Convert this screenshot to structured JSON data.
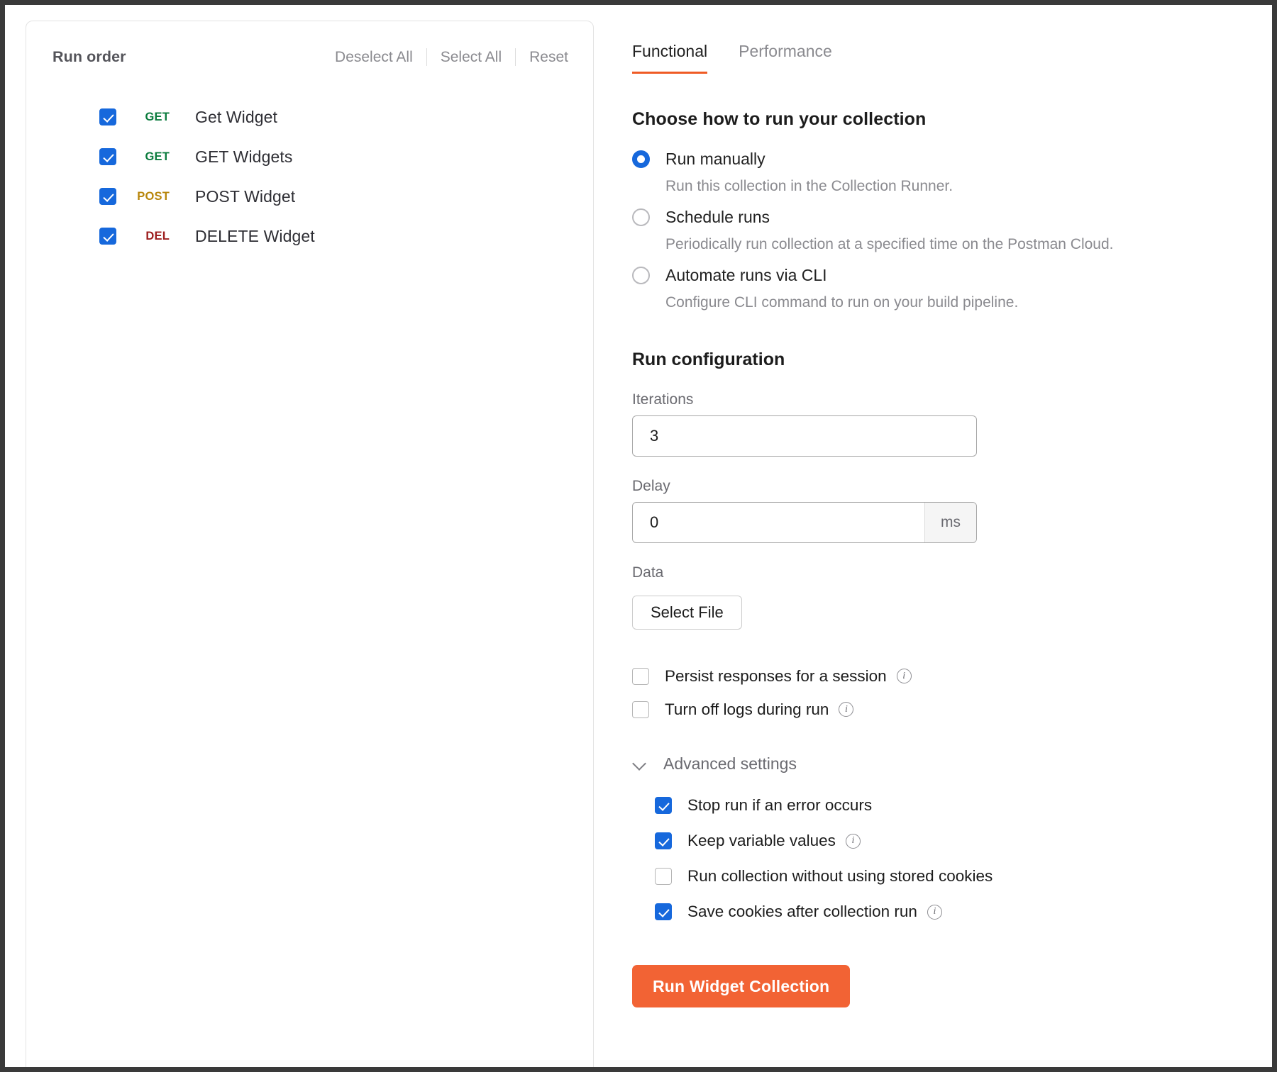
{
  "left_panel": {
    "title": "Run order",
    "actions": [
      {
        "label": "Deselect All"
      },
      {
        "label": "Select All"
      },
      {
        "label": "Reset"
      }
    ],
    "requests": [
      {
        "checked": true,
        "method": "GET",
        "method_color": "#0c7c3e",
        "name": "Get Widget"
      },
      {
        "checked": true,
        "method": "GET",
        "method_color": "#0c7c3e",
        "name": "GET Widgets"
      },
      {
        "checked": true,
        "method": "POST",
        "method_color": "#b8860b",
        "name": "POST Widget"
      },
      {
        "checked": true,
        "method": "DEL",
        "method_color": "#9c1c1c",
        "name": "DELETE Widget"
      }
    ]
  },
  "right_panel": {
    "tabs": [
      {
        "label": "Functional",
        "active": true
      },
      {
        "label": "Performance",
        "active": false
      }
    ],
    "choose_section": {
      "title": "Choose how to run your collection",
      "options": [
        {
          "label": "Run manually",
          "description": "Run this collection in the Collection Runner.",
          "selected": true
        },
        {
          "label": "Schedule runs",
          "description": "Periodically run collection at a specified time on the Postman Cloud.",
          "selected": false
        },
        {
          "label": "Automate runs via CLI",
          "description": "Configure CLI command to run on your build pipeline.",
          "selected": false
        }
      ]
    },
    "run_configuration": {
      "title": "Run configuration",
      "iterations": {
        "label": "Iterations",
        "value": "3"
      },
      "delay": {
        "label": "Delay",
        "value": "0",
        "suffix": "ms"
      },
      "data": {
        "label": "Data",
        "button_label": "Select File"
      },
      "options": [
        {
          "label": "Persist responses for a session",
          "checked": false,
          "info": true,
          "info_glyph": "i"
        },
        {
          "label": "Turn off logs during run",
          "checked": false,
          "info": true,
          "info_glyph": "i"
        }
      ],
      "advanced": {
        "label": "Advanced settings",
        "expanded": true,
        "options": [
          {
            "label": "Stop run if an error occurs",
            "checked": true,
            "info": false,
            "info_glyph": "i"
          },
          {
            "label": "Keep variable values",
            "checked": true,
            "info": true,
            "info_glyph": "i"
          },
          {
            "label": "Run collection without using stored cookies",
            "checked": false,
            "info": false,
            "info_glyph": "i"
          },
          {
            "label": "Save cookies after collection run",
            "checked": true,
            "info": true,
            "info_glyph": "i"
          }
        ]
      },
      "run_button_label": "Run Widget Collection"
    }
  },
  "colors": {
    "accent_orange": "#f26334",
    "checkbox_blue": "#1668dc",
    "get_green": "#0c7c3e",
    "post_yellow": "#b8860b",
    "delete_red": "#9c1c1c"
  }
}
